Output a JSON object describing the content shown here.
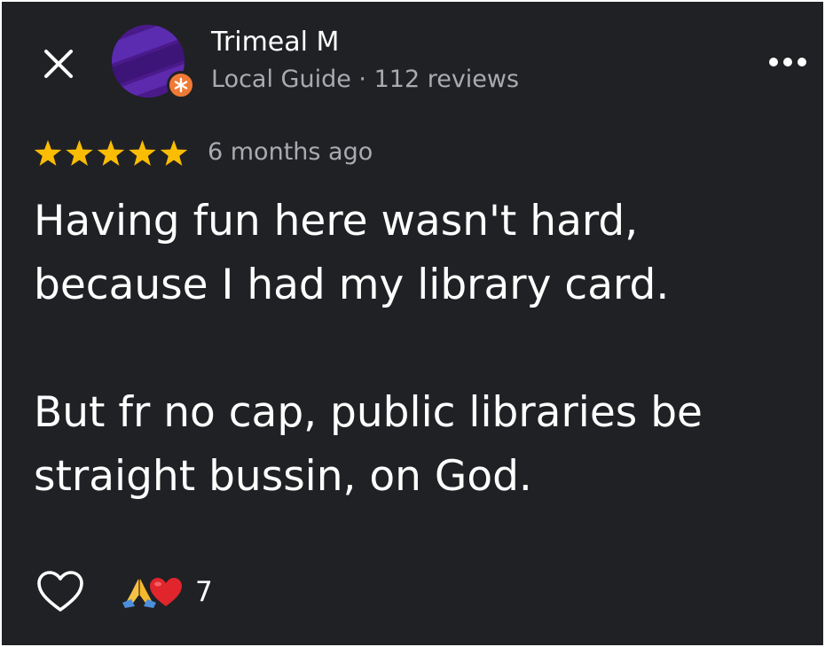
{
  "header": {
    "close_icon": "close-icon",
    "more_icon": "more-horizontal-icon"
  },
  "reviewer": {
    "name": "Trimeal M",
    "meta": "Local Guide · 112 reviews",
    "avatar_color": "#4a1a8a",
    "badge_color": "#f07a35"
  },
  "review": {
    "rating": 5,
    "max_rating": 5,
    "star_color": "#fbbc04",
    "time": "6 months ago",
    "paragraphs": [
      "Having fun here wasn't hard, because I had my library card.",
      "But fr no cap, public libraries be straight bussin, on God."
    ]
  },
  "footer": {
    "like_icon": "heart-outline-icon",
    "reaction_icons": [
      "folded-hands-icon",
      "red-heart-icon"
    ],
    "reaction_count": "7"
  },
  "colors": {
    "background": "#202124",
    "text": "#ffffff",
    "secondary_text": "#a8abb0"
  }
}
